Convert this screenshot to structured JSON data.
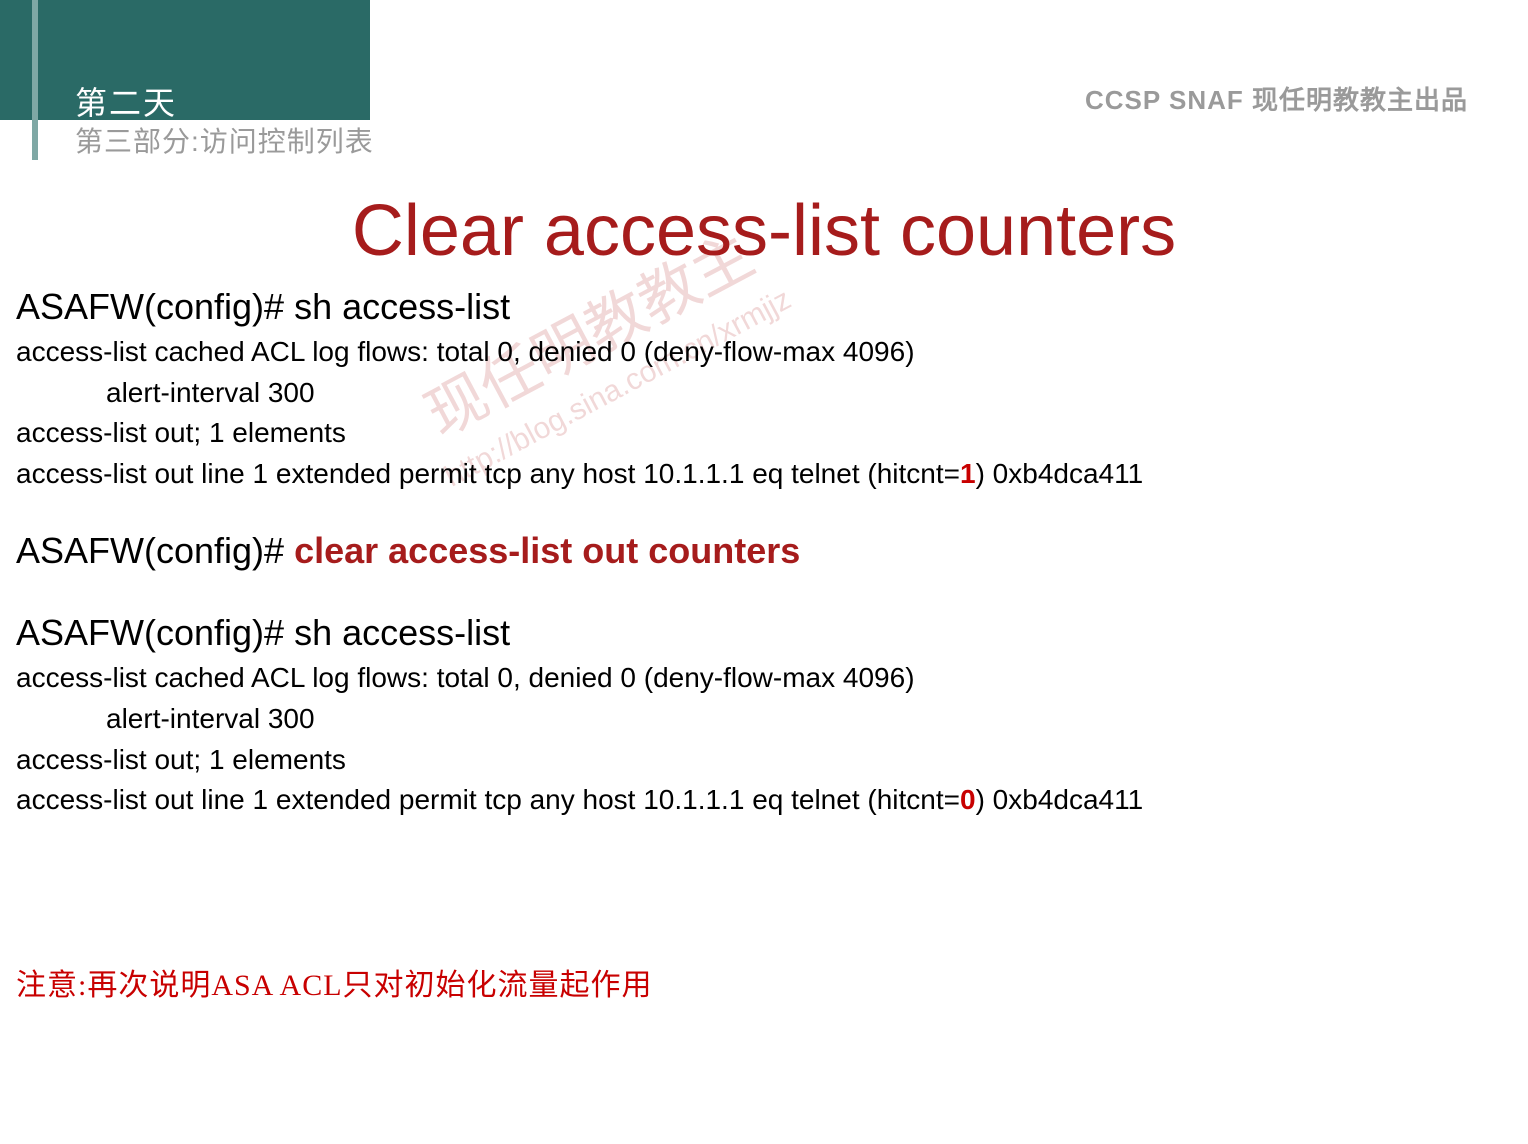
{
  "header": {
    "day": "第二天",
    "section": "第三部分:访问控制列表",
    "top_right": "CCSP SNAF  现任明教教主出品"
  },
  "title": "Clear access-list counters",
  "block1": {
    "cmd": "ASAFW(config)# sh access-list",
    "line1": "access-list cached ACL log flows: total 0, denied 0 (deny-flow-max 4096)",
    "line2": "alert-interval 300",
    "line3": "access-list out; 1 elements",
    "line4a": "access-list out line 1 extended permit tcp any host 10.1.1.1 eq telnet (hitcnt=",
    "line4_hit": "1",
    "line4b": ") 0xb4dca411"
  },
  "block2": {
    "prompt": "ASAFW(config)# ",
    "cmd_red": "clear access-list out counters"
  },
  "block3": {
    "cmd": "ASAFW(config)# sh access-list",
    "line1": "access-list cached ACL log flows: total 0, denied 0 (deny-flow-max 4096)",
    "line2": "alert-interval 300",
    "line3": "access-list out; 1 elements",
    "line4a": "access-list out line 1 extended permit tcp any host 10.1.1.1 eq telnet (hitcnt=",
    "line4_hit": "0",
    "line4b": ") 0xb4dca411"
  },
  "note": "注意:再次说明ASA ACL只对初始化流量起作用",
  "watermark": {
    "main": "现任明教教主",
    "url": "http://blog.sina.com.cn/xrmjjz"
  }
}
